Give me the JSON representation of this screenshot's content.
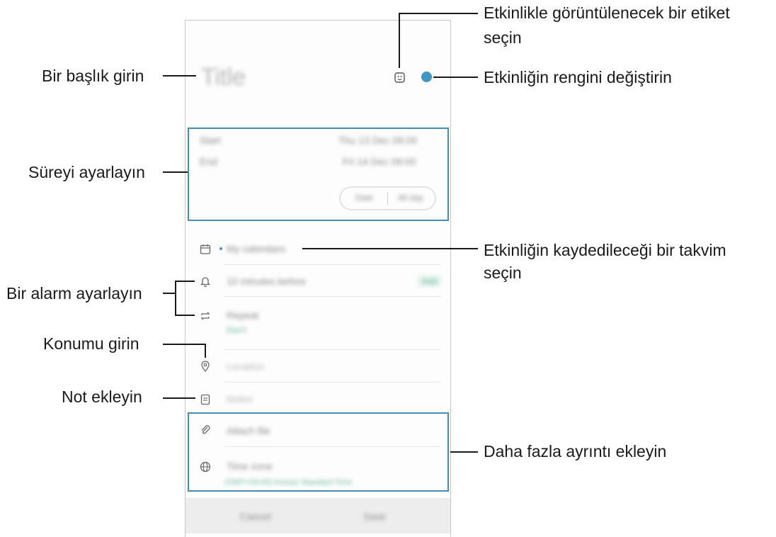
{
  "screen": {
    "title_placeholder": "Title",
    "start_label": "Start",
    "start_value": "Thu 13 Dec 09:00",
    "end_label": "End",
    "end_value": "Fri 14 Dec 09:00",
    "toggle_a": "Date",
    "toggle_b": "All day",
    "calendar_value": "My calendars",
    "alarm_value": "10 minutes before",
    "alarm_badge": "Add",
    "repeat_label": "Repeat",
    "repeat_value": "Don't",
    "location_placeholder": "Location",
    "notes_placeholder": "Notes",
    "attach_label": "Attach file",
    "timezone_label": "Time zone",
    "timezone_value": "(GMT+09:00) Korean Standard Time",
    "cancel_label": "Cancel",
    "save_label": "Save",
    "color_dot": "#3d97c4"
  },
  "callouts": {
    "title": "Bir başlık girin",
    "duration": "Süreyi ayarlayın",
    "alarm": "Bir alarm ayarlayın",
    "location": "Konumu girin",
    "notes": "Not ekleyin",
    "sticker_line1": "Etkinlikle görüntülenecek bir etiket",
    "sticker_line2": "seçin",
    "color": "Etkinliğin rengini değiştirin",
    "calendar_line1": "Etkinliğin kaydedileceği bir takvim",
    "calendar_line2": "seçin",
    "details": "Daha fazla ayrıntı ekleyin"
  }
}
